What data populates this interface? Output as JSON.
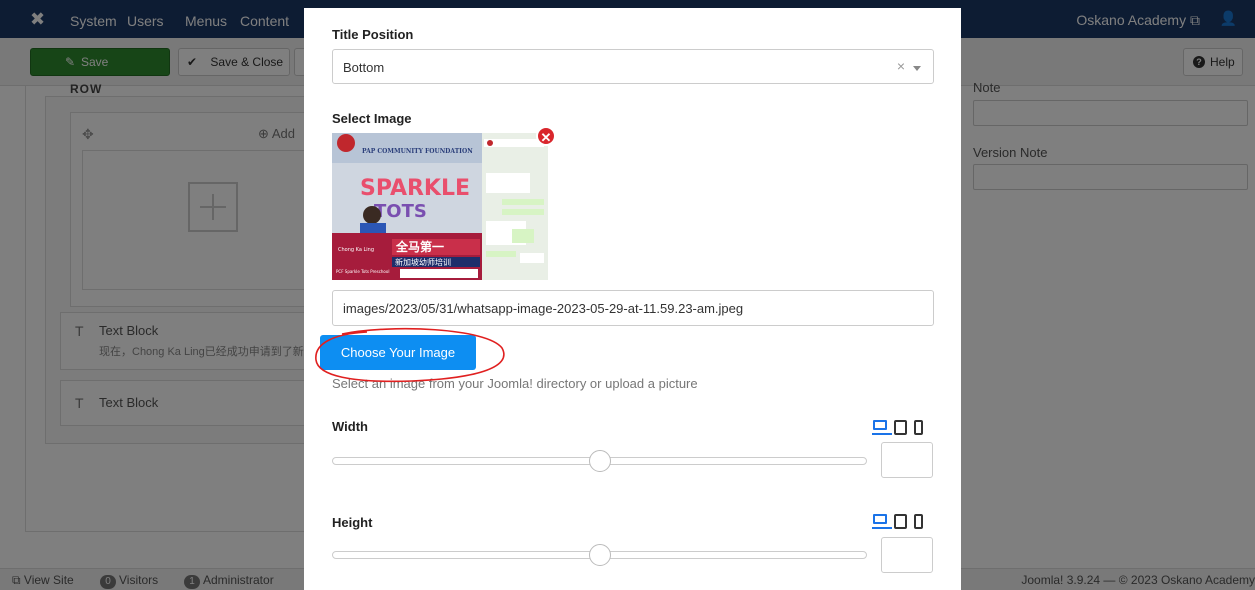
{
  "topbar": {
    "logo_icon": "joomla-icon",
    "menu": [
      "System",
      "Users",
      "Menus",
      "Content"
    ],
    "site_name": "Oskano Academy",
    "user_icon": "user-icon"
  },
  "toolbar": {
    "save_label": "Save",
    "save_close_label": "Save & Close",
    "help_label": "Help"
  },
  "builder": {
    "row_label": "ROW",
    "addon_label": "Add",
    "text_block_1": {
      "title": "Text Block",
      "summary": "现在，Chong Ka Ling已经成功申请到了新"
    },
    "text_block_2": {
      "title": "Text Block"
    }
  },
  "right_panel": {
    "note_label": "Note",
    "version_note_label": "Version Note"
  },
  "statusbar": {
    "view_site": "View Site",
    "visitors_count": "0",
    "visitors": "Visitors",
    "admin_count": "1",
    "administrator": "Administrator",
    "copyright": "Joomla! 3.9.24 — © 2023 Oskano Academy"
  },
  "modal": {
    "title_position_label": "Title Position",
    "title_position_value": "Bottom",
    "select_image_label": "Select Image",
    "image_path": "images/2023/05/31/whatsapp-image-2023-05-29-at-11.59.23-am.jpeg",
    "choose_button": "Choose Your Image",
    "help_text": "Select an image from your Joomla! directory or upload a picture",
    "width_label": "Width",
    "height_label": "Height",
    "width_value": "",
    "height_value": "",
    "width_slider_fraction": 0.5,
    "height_slider_fraction": 0.5,
    "device_icons": [
      "desktop-icon",
      "tablet-icon",
      "mobile-icon"
    ],
    "thumbnail": {
      "banner_text": "PAP COMMUNITY FOUNDATION",
      "sign_top": "SPARKLE",
      "sign_bottom": "TOTS",
      "headline": "全马第一",
      "subline": "新加坡幼师培训",
      "person_name": "Chong Ka Ling",
      "school": "PCF Sparkle Tots Preschool"
    }
  },
  "colors": {
    "primary_blue": "#0d8ef2",
    "save_green": "#2f8b2f",
    "remove_red": "#d9262c",
    "topbar": "#1a3867",
    "annotation_red": "#e02020"
  }
}
